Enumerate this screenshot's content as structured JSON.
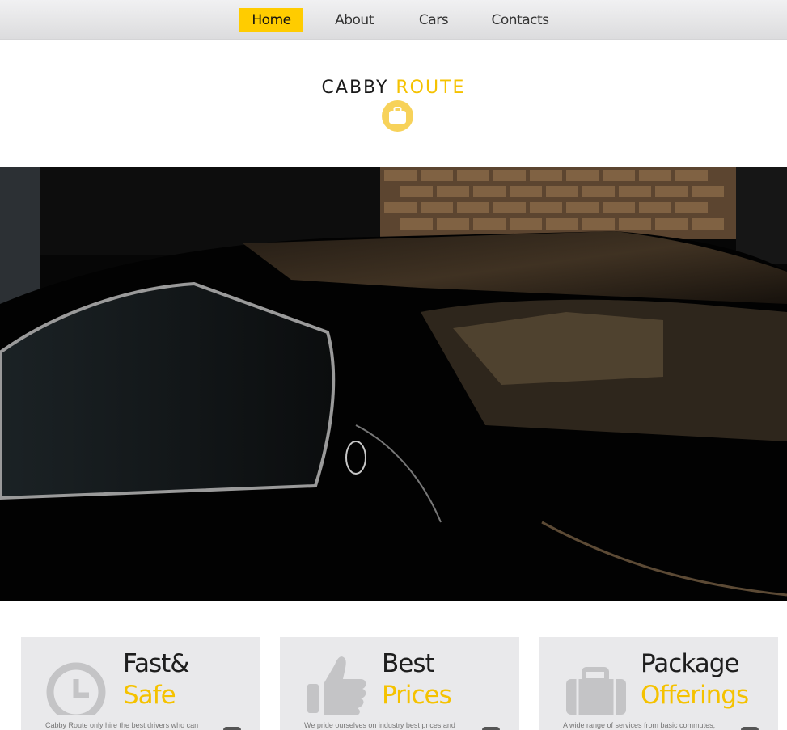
{
  "nav": {
    "items": [
      {
        "label": "Home",
        "active": true
      },
      {
        "label": "About",
        "active": false
      },
      {
        "label": "Cars",
        "active": false
      },
      {
        "label": "Contacts",
        "active": false
      }
    ]
  },
  "logo": {
    "word1": "CABBY",
    "word2": "ROUTE",
    "badge_icon": "briefcase-icon"
  },
  "colors": {
    "accent": "#ffcc00",
    "card_bg": "#e9e9eb"
  },
  "features": [
    {
      "title_line1": "Fast&",
      "title_line2": "Safe",
      "icon": "clock-icon",
      "desc": "Cabby Route only hire the best drivers who can"
    },
    {
      "title_line1": "Best",
      "title_line2": "Prices",
      "icon": "thumbs-up-icon",
      "desc": "We pride ourselves on industry best prices and"
    },
    {
      "title_line1": "Package",
      "title_line2": "Offerings",
      "icon": "briefcase-icon",
      "desc": "A wide range of services from basic commutes,"
    }
  ]
}
